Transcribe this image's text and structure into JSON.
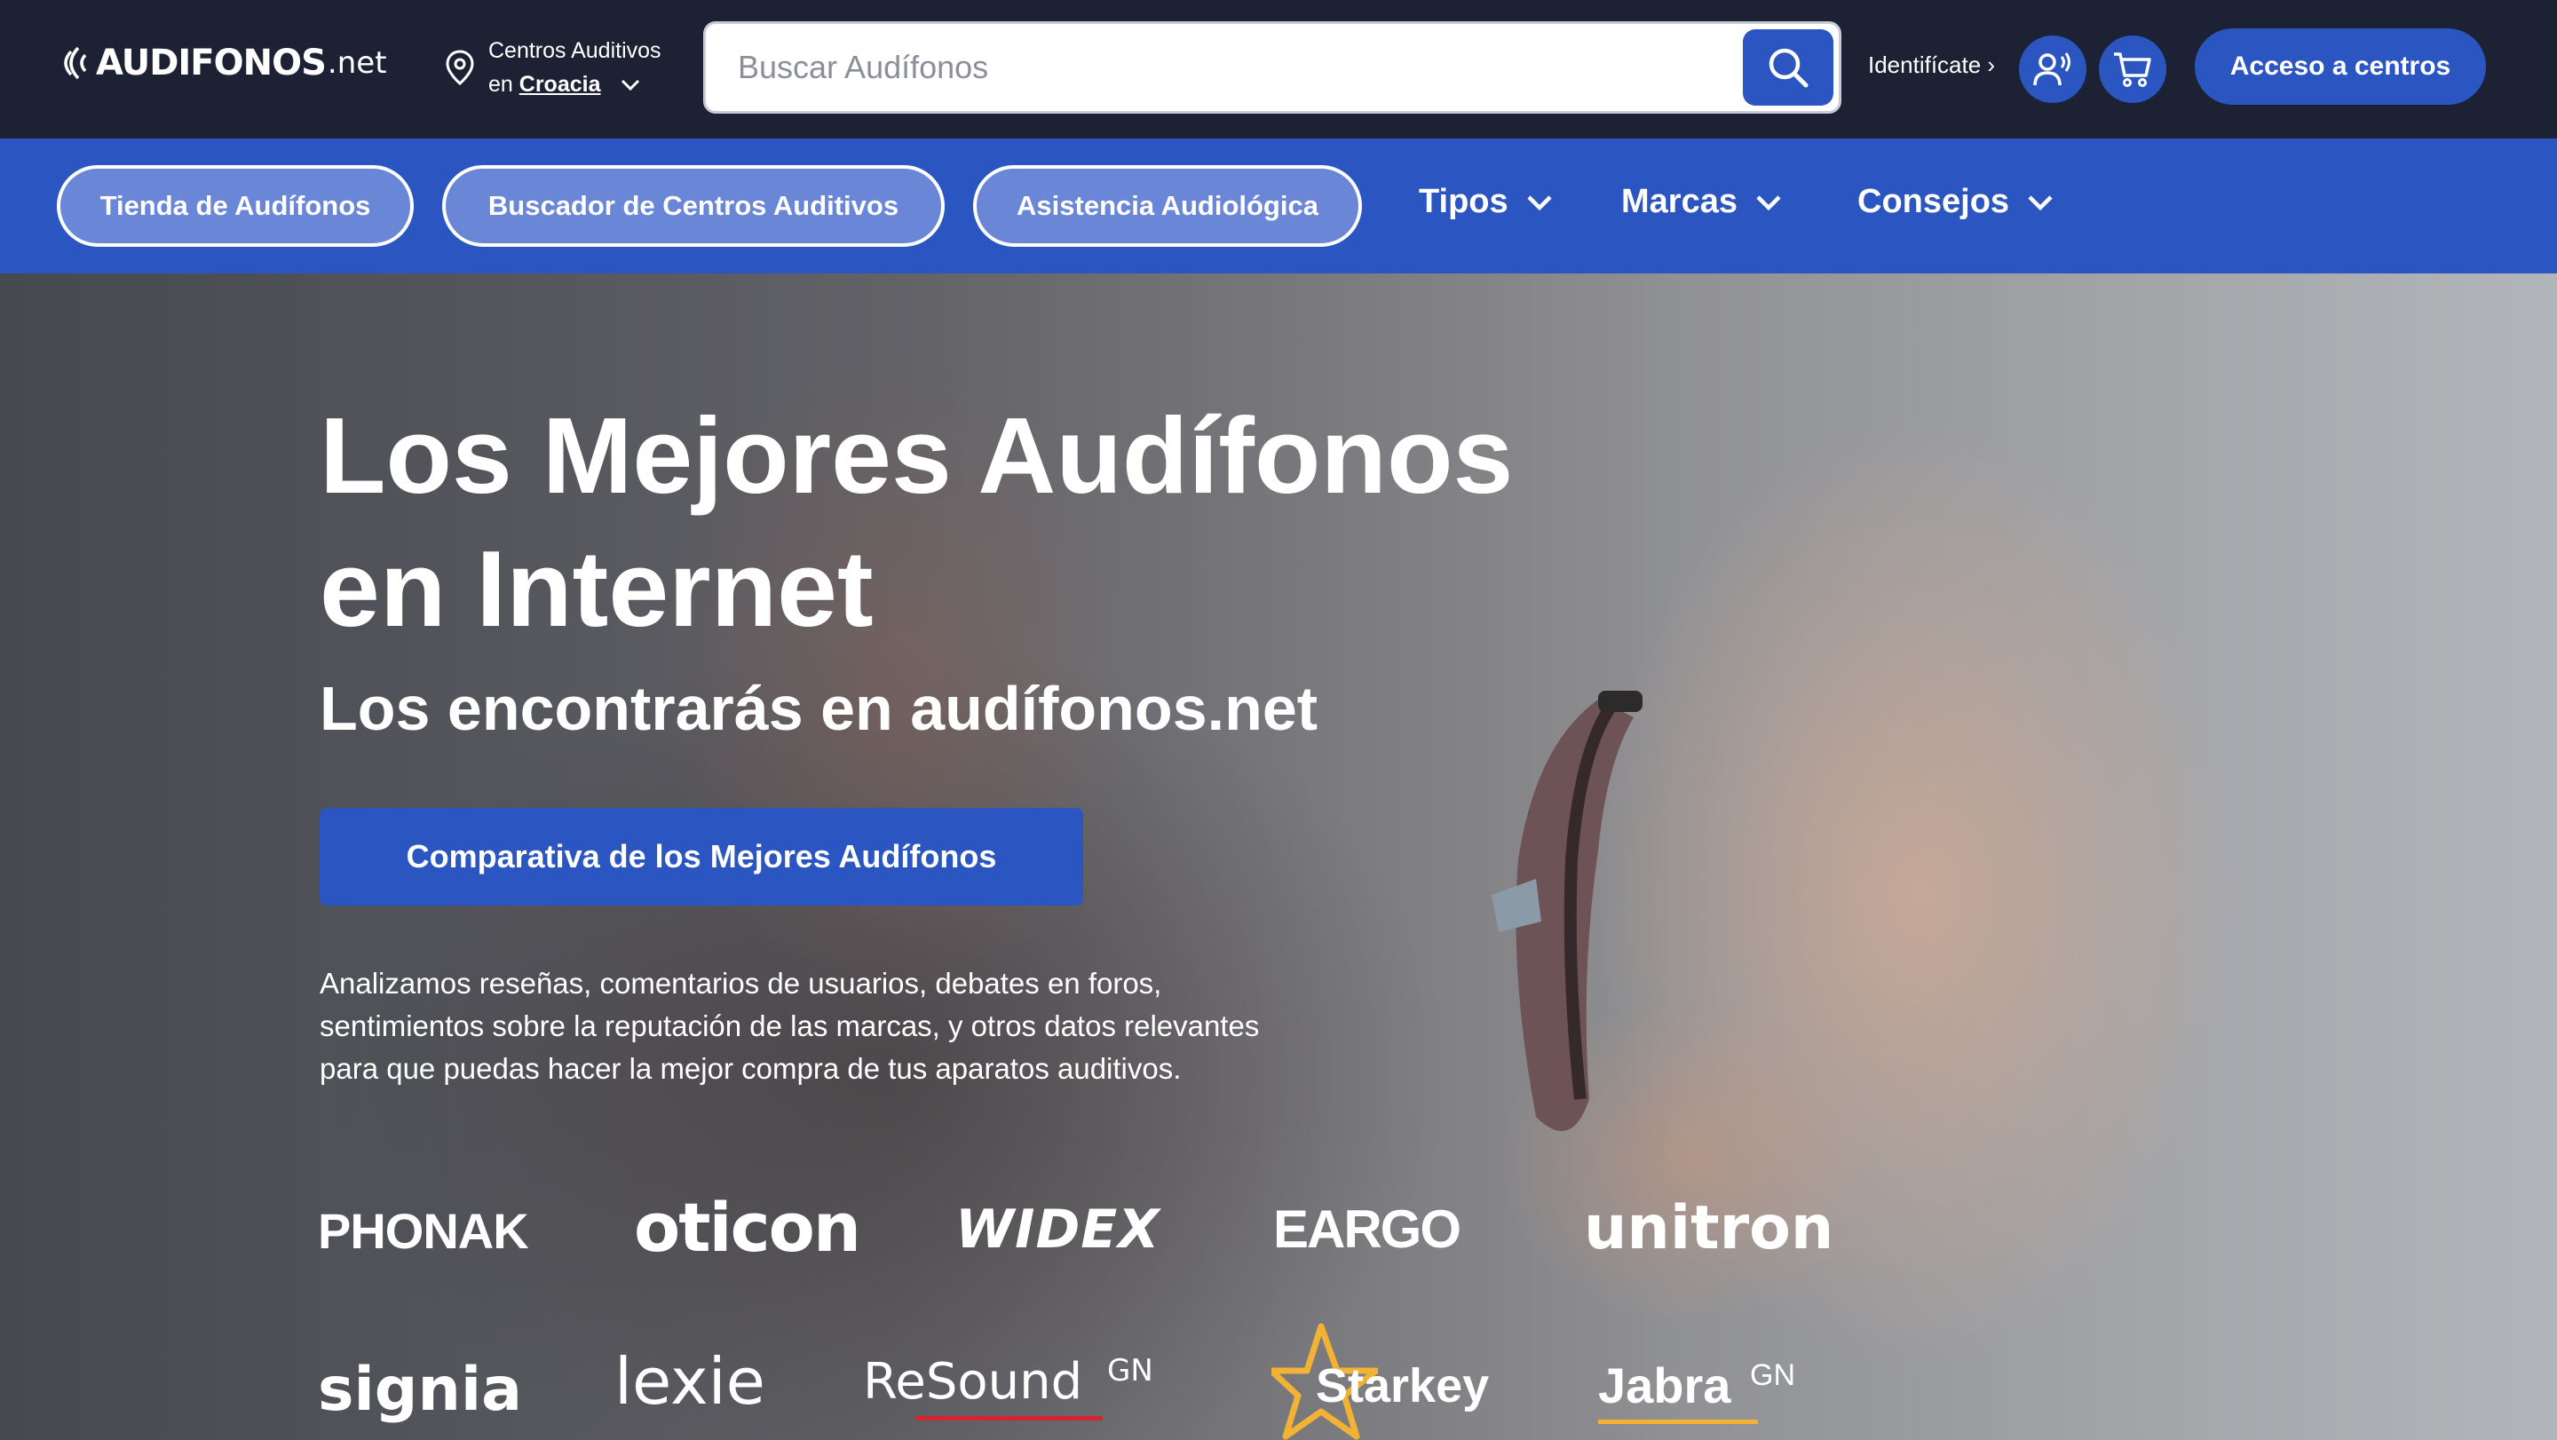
{
  "header": {
    "logo_brand": "AUDIFONOS",
    "logo_tld": ".net",
    "location_line1": "Centros Auditivos",
    "location_prefix": "en",
    "location_country": "Croacia",
    "search_placeholder": "Buscar Audífonos",
    "identify_label": "Identifícate ›",
    "access_button": "Acceso a centros"
  },
  "nav": {
    "pills": [
      "Tienda de Audífonos",
      "Buscador de Centros Auditivos",
      "Asistencia Audiológica"
    ],
    "dropdowns": [
      "Tipos",
      "Marcas",
      "Consejos"
    ]
  },
  "hero": {
    "title_line1": "Los Mejores Audífonos",
    "title_line2": "en Internet",
    "subtitle": "Los encontrarás en audífonos.net",
    "cta": "Comparativa de los Mejores Audífonos",
    "description_line1": "Analizamos reseñas, comentarios de usuarios, debates en foros,",
    "description_line2": "sentimientos sobre la reputación de las marcas, y otros datos relevantes",
    "description_line3": "para que puedas hacer la mejor compra de tus aparatos auditivos."
  },
  "brands": {
    "row1": [
      "PHONAK",
      "oticon",
      "WIDEX",
      "EARGO",
      "unitron"
    ],
    "row2": [
      "signia",
      "lexie",
      "ReSound",
      "Starkey",
      "Jabra"
    ],
    "gn_suffix": "GN"
  },
  "colors": {
    "header_bg": "#1c2233",
    "primary_blue": "#2b56c2",
    "pill_bg": "#6a86d6",
    "signia_red": "#d8232a",
    "starkey_gold": "#f2b233"
  }
}
